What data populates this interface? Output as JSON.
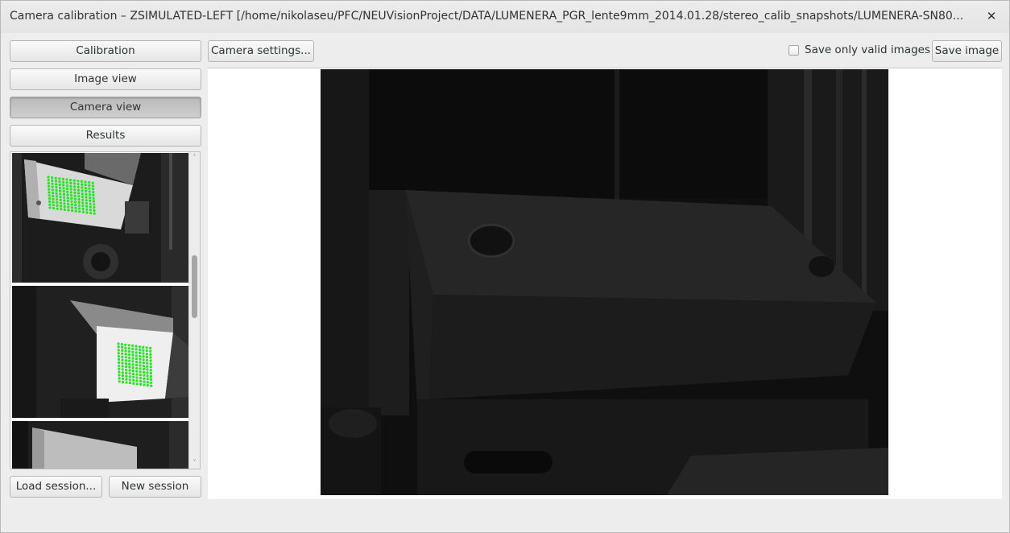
{
  "window": {
    "title": "Camera calibration – ZSIMULATED-LEFT [/home/nikolaseu/PFC/NEUVisionProject/DATA/LUMENERA_PGR_lente9mm_2014.01.28/stereo_calib_snapshots/LUMENERA-SN80...",
    "close_icon": "close-icon",
    "close_glyph": "✕"
  },
  "sidebar": {
    "buttons": [
      {
        "label": "Calibration",
        "pressed": false
      },
      {
        "label": "Image view",
        "pressed": false
      },
      {
        "label": "Camera view",
        "pressed": true
      },
      {
        "label": "Results",
        "pressed": false
      }
    ],
    "thumbnails": {
      "scroll_up_glyph": "˄",
      "scroll_down_glyph": "˅"
    },
    "load_session_label": "Load session...",
    "new_session_label": "New session"
  },
  "toolbar": {
    "camera_settings_label": "Camera settings...",
    "save_valid_label": "Save only valid images",
    "save_valid_checked": false,
    "save_image_label": "Save image"
  },
  "colors": {
    "detected_points": "#22e622",
    "pressed_button": "#c3c3c3"
  }
}
